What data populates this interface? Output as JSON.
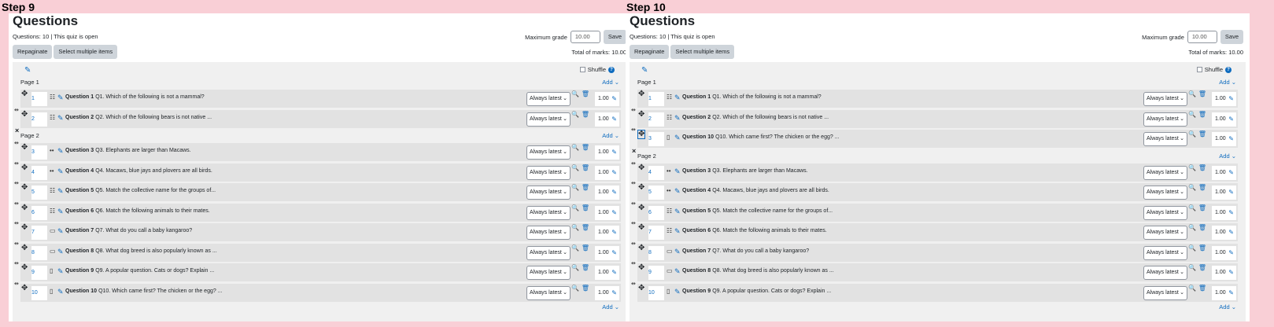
{
  "steps": [
    {
      "label": "Step 9",
      "title": "Questions",
      "status": "Questions: 10 | This quiz is open",
      "max_grade_label": "Maximum grade",
      "max_grade_value": "10.00",
      "save_label": "Save",
      "repaginate_label": "Repaginate",
      "select_multiple_label": "Select multiple items",
      "total_marks": "Total of marks: 10.00",
      "shuffle_label": "Shuffle",
      "add_label": "Add",
      "version_label": "Always latest",
      "pages": [
        {
          "label": "Page 1",
          "slots": [
            {
              "num": "1",
              "icon": "multichoice",
              "name": "Question 1",
              "text": "Q1. Which of the following is not a mammal?",
              "mark": "1.00"
            },
            {
              "num": "2",
              "icon": "multichoice",
              "name": "Question 2",
              "text": "Q2. Which of the following bears is not native ...",
              "mark": "1.00"
            }
          ]
        },
        {
          "label": "Page 2",
          "slots": [
            {
              "num": "3",
              "icon": "truefalse",
              "name": "Question 3",
              "text": "Q3. Elephants are larger than Macaws.",
              "mark": "1.00"
            },
            {
              "num": "4",
              "icon": "truefalse",
              "name": "Question 4",
              "text": "Q4. Macaws, blue jays and plovers are all birds.",
              "mark": "1.00"
            },
            {
              "num": "5",
              "icon": "match",
              "name": "Question 5",
              "text": "Q5. Match the collective name for the groups of...",
              "mark": "1.00"
            },
            {
              "num": "6",
              "icon": "match",
              "name": "Question 6",
              "text": "Q6. Match the following animals to their mates.",
              "mark": "1.00"
            },
            {
              "num": "7",
              "icon": "shortanswer",
              "name": "Question 7",
              "text": "Q7. What do you call a baby kangaroo?",
              "mark": "1.00"
            },
            {
              "num": "8",
              "icon": "shortanswer",
              "name": "Question 8",
              "text": "Q8. What dog breed is also popularly known as ...",
              "mark": "1.00"
            },
            {
              "num": "9",
              "icon": "essay",
              "name": "Question 9",
              "text": "Q9. A popular question. Cats or dogs? Explain ...",
              "mark": "1.00"
            },
            {
              "num": "10",
              "icon": "essay",
              "name": "Question 10",
              "text": "Q10. Which came first? The chicken or the egg? ...",
              "mark": "1.00"
            }
          ]
        }
      ]
    },
    {
      "label": "Step 10",
      "title": "Questions",
      "status": "Questions: 10 | This quiz is open",
      "max_grade_label": "Maximum grade",
      "max_grade_value": "10.00",
      "save_label": "Save",
      "repaginate_label": "Repaginate",
      "select_multiple_label": "Select multiple items",
      "total_marks": "Total of marks: 10.00",
      "shuffle_label": "Shuffle",
      "add_label": "Add",
      "version_label": "Always latest",
      "pages": [
        {
          "label": "Page 1",
          "slots": [
            {
              "num": "1",
              "icon": "multichoice",
              "name": "Question 1",
              "text": "Q1. Which of the following is not a mammal?",
              "mark": "1.00"
            },
            {
              "num": "2",
              "icon": "multichoice",
              "name": "Question 2",
              "text": "Q2. Which of the following bears is not native ...",
              "mark": "1.00"
            },
            {
              "num": "3",
              "icon": "essay",
              "name": "Question 10",
              "text": "Q10. Which came first? The chicken or the egg? ...",
              "mark": "1.00",
              "focused": true
            }
          ]
        },
        {
          "label": "Page 2",
          "slots": [
            {
              "num": "4",
              "icon": "truefalse",
              "name": "Question 3",
              "text": "Q3. Elephants are larger than Macaws.",
              "mark": "1.00"
            },
            {
              "num": "5",
              "icon": "truefalse",
              "name": "Question 4",
              "text": "Q4. Macaws, blue jays and plovers are all birds.",
              "mark": "1.00"
            },
            {
              "num": "6",
              "icon": "match",
              "name": "Question 5",
              "text": "Q5. Match the collective name for the groups of...",
              "mark": "1.00"
            },
            {
              "num": "7",
              "icon": "match",
              "name": "Question 6",
              "text": "Q6. Match the following animals to their mates.",
              "mark": "1.00"
            },
            {
              "num": "8",
              "icon": "shortanswer",
              "name": "Question 7",
              "text": "Q7. What do you call a baby kangaroo?",
              "mark": "1.00"
            },
            {
              "num": "9",
              "icon": "shortanswer",
              "name": "Question 8",
              "text": "Q8. What dog breed is also popularly known as ...",
              "mark": "1.00"
            },
            {
              "num": "10",
              "icon": "essay",
              "name": "Question 9",
              "text": "Q9. A popular question. Cats or dogs? Explain ...",
              "mark": "1.00"
            }
          ]
        }
      ]
    }
  ]
}
